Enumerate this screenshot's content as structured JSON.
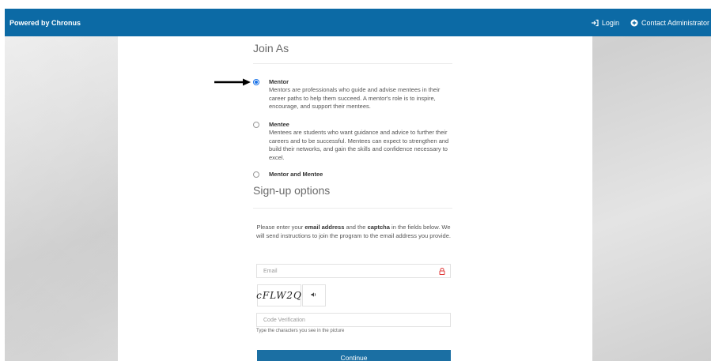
{
  "colors": {
    "navbar": "#0c6aa5",
    "primary_button": "#1b6fa3",
    "radio_selected": "#1a73e8"
  },
  "nav": {
    "brand": "Powered by Chronus",
    "login": {
      "label": "Login",
      "icon": "login-icon"
    },
    "contact": {
      "label": "Contact Administrator",
      "icon": "plus-circle-icon"
    }
  },
  "join_as": {
    "title": "Join As",
    "options": [
      {
        "label": "Mentor",
        "description": "Mentors are professionals who guide and advise mentees in their career paths to help them succeed. A mentor's role is to inspire, encourage, and support their mentees.",
        "selected": true
      },
      {
        "label": "Mentee",
        "description": "Mentees are students who want guidance and advice to further their careers and to be successful. Mentees can expect to strengthen and build their networks, and gain the skills and confidence necessary to excel.",
        "selected": false
      },
      {
        "label": "Mentor and Mentee",
        "description": "",
        "selected": false
      }
    ]
  },
  "signup": {
    "title": "Sign-up options",
    "instructions": {
      "part1": "Please enter your ",
      "bold1": "email address",
      "part2": " and the ",
      "bold2": "captcha",
      "part3": " in the fields below. We will send instructions to join the program to the email address you provide."
    },
    "email_placeholder": "Email",
    "captcha_text": "cFLW2Q",
    "audio_icon": "speaker-icon",
    "code_placeholder": "Code Verification",
    "hint": "Type the characters you see in the picture",
    "continue_label": "Continue"
  }
}
